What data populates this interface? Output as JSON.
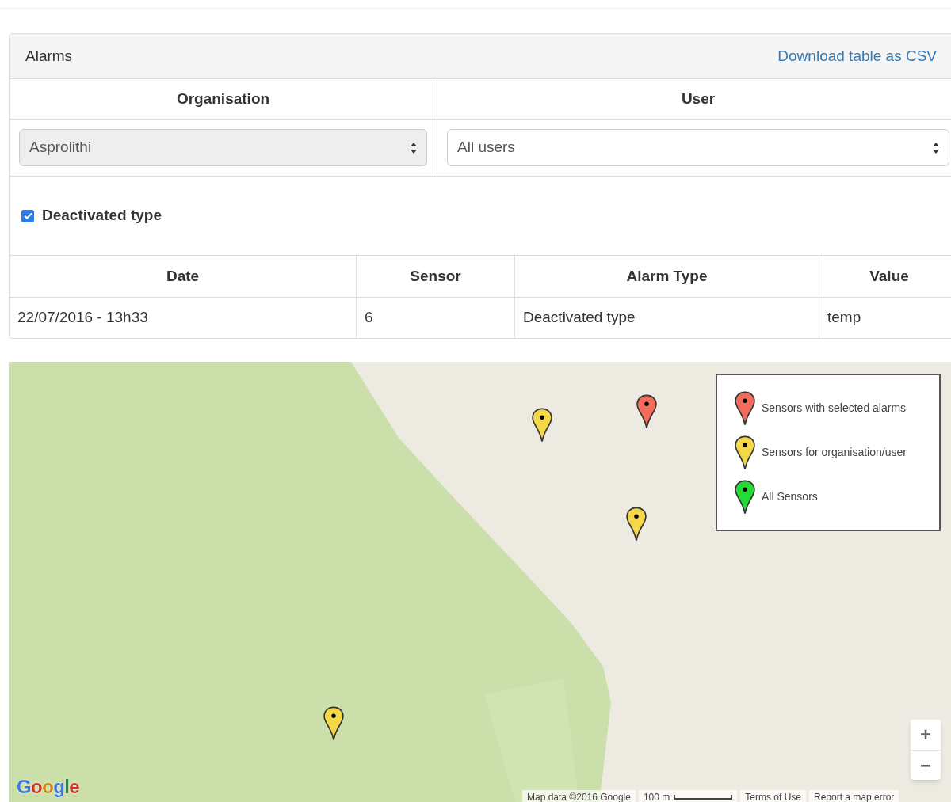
{
  "panel": {
    "title": "Alarms",
    "download_link": "Download table as CSV"
  },
  "filters": {
    "columns": [
      "Organisation",
      "User"
    ],
    "organisation": {
      "value": "Asprolithi",
      "disabled": true
    },
    "user": {
      "value": "All users",
      "disabled": false
    }
  },
  "checkbox": {
    "label": "Deactivated type",
    "checked": true
  },
  "table": {
    "columns": [
      "Date",
      "Sensor",
      "Alarm Type",
      "Value"
    ],
    "rows": [
      [
        "22/07/2016 - 13h33",
        "6",
        "Deactivated type",
        "temp"
      ]
    ]
  },
  "map": {
    "kind": "picture",
    "markers": [
      {
        "color": "#f4d848"
      },
      {
        "color": "#f26b5b"
      },
      {
        "color": "#f4d848"
      },
      {
        "color": "#f4d848"
      }
    ],
    "legend": [
      {
        "label": "Sensors with selected alarms",
        "color": "#f26b5b"
      },
      {
        "label": "Sensors for organisation/user",
        "color": "#f4d848"
      },
      {
        "label": "All Sensors",
        "color": "#22dd33"
      }
    ],
    "zoom_in": "+",
    "zoom_out": "−",
    "logo": "Google",
    "attribution": "Map data ©2016 Google",
    "scale": "100 m",
    "terms": "Terms of Use",
    "report": "Report a map error"
  }
}
